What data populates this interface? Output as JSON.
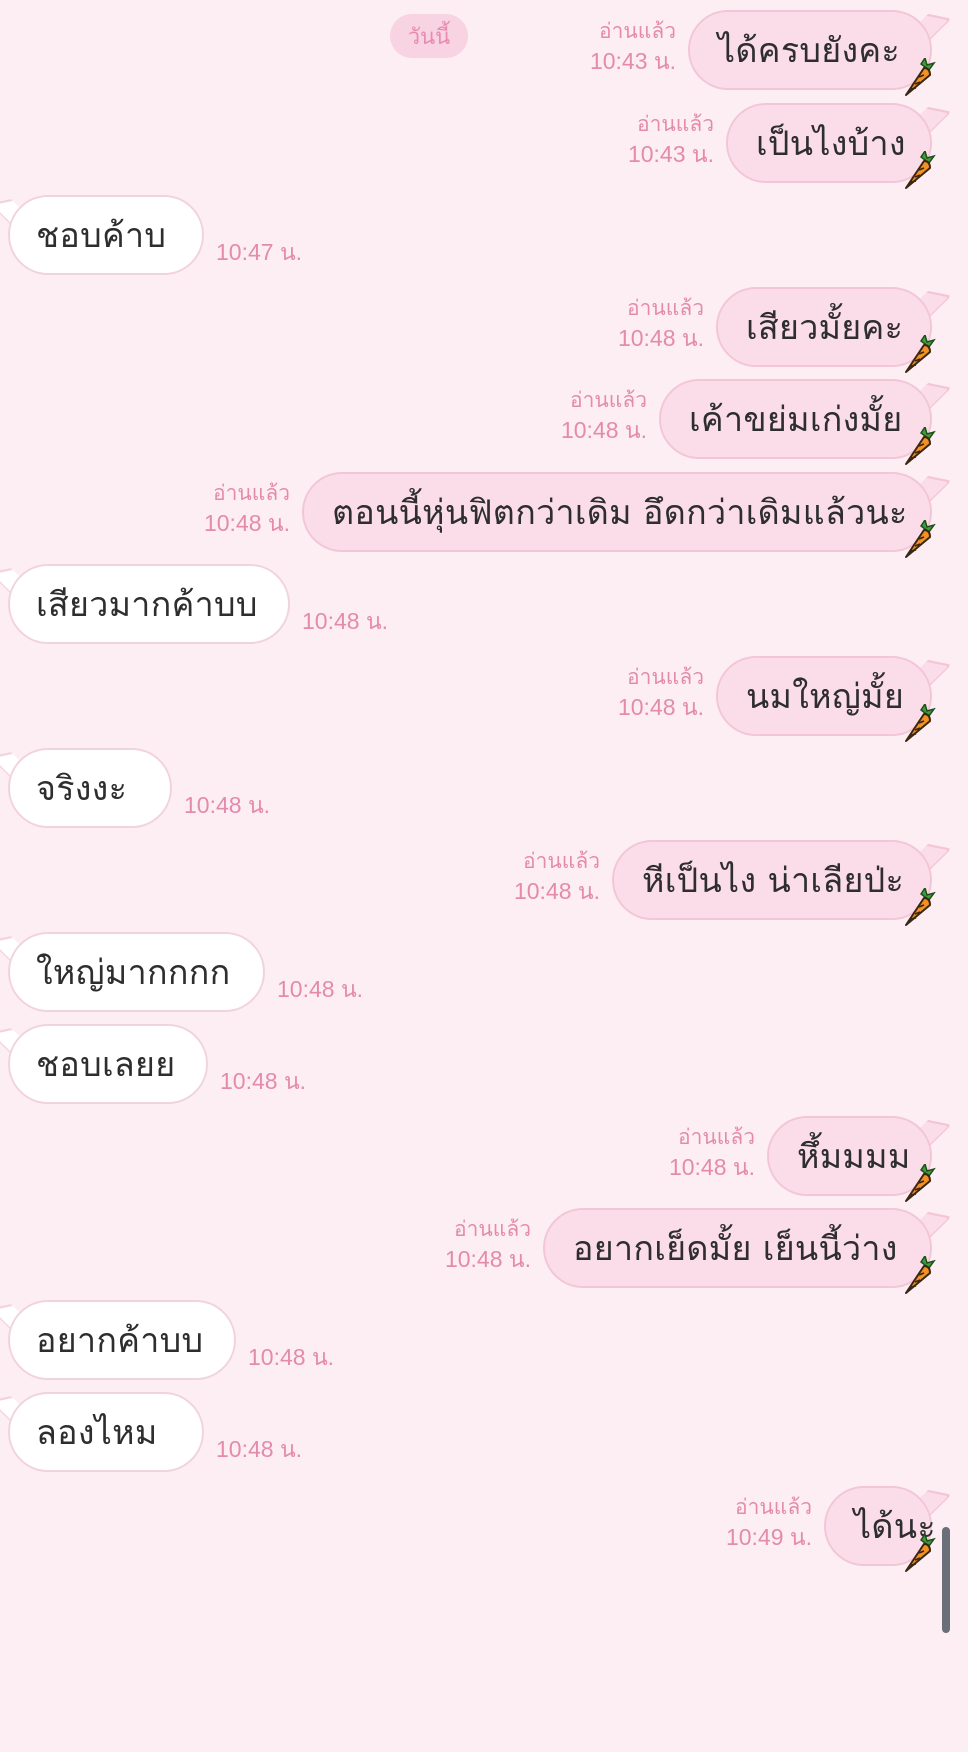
{
  "date_label": "วันนี้",
  "read_label": "อ่านแล้ว",
  "messages": [
    {
      "side": "out",
      "text": "ได้ครบยังคะ",
      "time": "10:43 น.",
      "read": true
    },
    {
      "side": "out",
      "text": "เป็นไงบ้าง",
      "time": "10:43 น.",
      "read": true
    },
    {
      "side": "in",
      "text": "ชอบค้าบ",
      "time": "10:47 น."
    },
    {
      "side": "out",
      "text": "เสียวมั้ยคะ",
      "time": "10:48 น.",
      "read": true
    },
    {
      "side": "out",
      "text": "เค้าขย่มเก่งมั้ย",
      "time": "10:48 น.",
      "read": true
    },
    {
      "side": "out",
      "text": "ตอนนี้หุ่นฟิตกว่าเดิม อึดกว่าเดิมแล้วนะ",
      "time": "10:48 น.",
      "read": true
    },
    {
      "side": "in",
      "text": "เสียวมากค้าบบ",
      "time": "10:48 น."
    },
    {
      "side": "out",
      "text": "นมใหญ่มั้ย",
      "time": "10:48 น.",
      "read": true
    },
    {
      "side": "in",
      "text": "จริงงะ",
      "time": "10:48 น."
    },
    {
      "side": "out",
      "text": "หีเป็นไง น่าเลียป่ะ",
      "time": "10:48 น.",
      "read": true
    },
    {
      "side": "in",
      "text": "ใหญ่มากกกก",
      "time": "10:48 น."
    },
    {
      "side": "in",
      "text": "ชอบเลยย",
      "time": "10:48 น."
    },
    {
      "side": "out",
      "text": "หึ้มมมม",
      "time": "10:48 น.",
      "read": true
    },
    {
      "side": "out",
      "text": "อยากเย็ดมั้ย เย็นนี้ว่าง",
      "time": "10:48 น.",
      "read": true
    },
    {
      "side": "in",
      "text": "อยากค้าบบ",
      "time": "10:48 น."
    },
    {
      "side": "in",
      "text": "ลองไหม",
      "time": "10:48 น."
    },
    {
      "side": "out",
      "text": "ได้นะ",
      "time": "10:49 น.",
      "read": true
    }
  ],
  "sticker_icon": "carrot-icon",
  "colors": {
    "background": "#fdeef3",
    "outgoing_bubble": "#fbdde9",
    "incoming_bubble": "#ffffff",
    "meta_text": "#e48bab"
  }
}
